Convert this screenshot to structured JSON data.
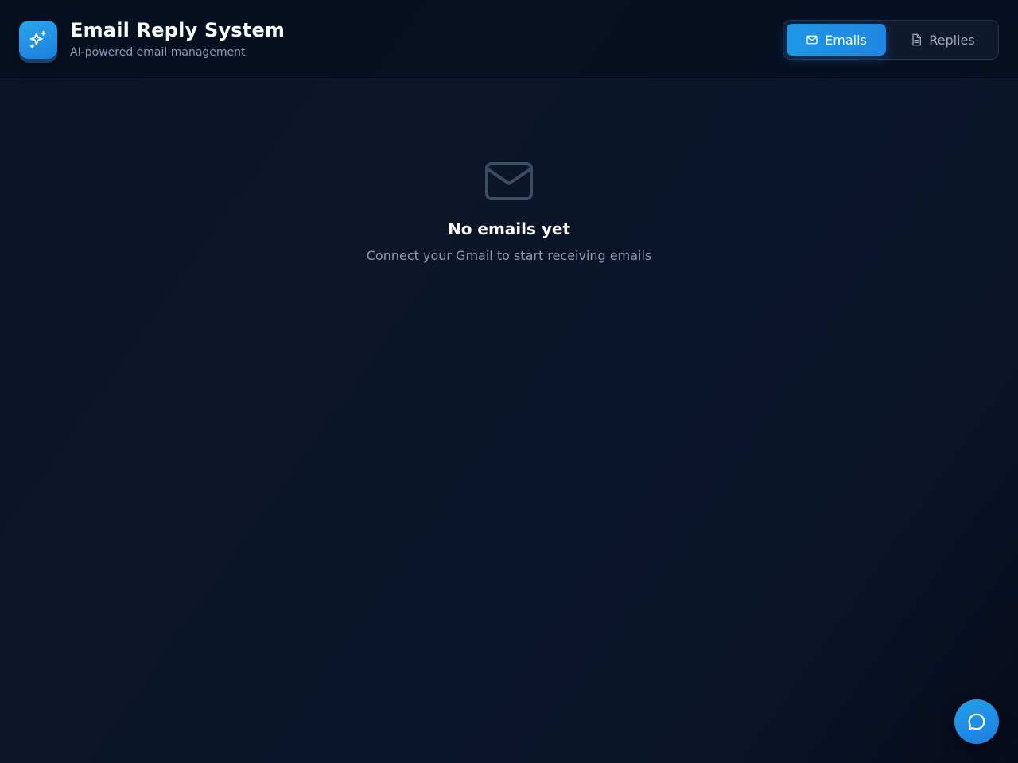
{
  "app": {
    "title": "Email Reply System",
    "subtitle": "AI-powered email management",
    "logo_icon": "sparkles-icon"
  },
  "tabs": [
    {
      "label": "Emails",
      "icon": "mail-icon",
      "active": true
    },
    {
      "label": "Replies",
      "icon": "document-icon",
      "active": false
    }
  ],
  "empty_state": {
    "icon": "mail-icon",
    "title": "No emails yet",
    "message": "Connect your Gmail to start receiving emails"
  },
  "chat_button": {
    "icon": "chat-bubble-icon"
  },
  "colors": {
    "accent": "#1e8fe3",
    "background": "#0a1426",
    "muted_text": "#8e9cb2"
  }
}
